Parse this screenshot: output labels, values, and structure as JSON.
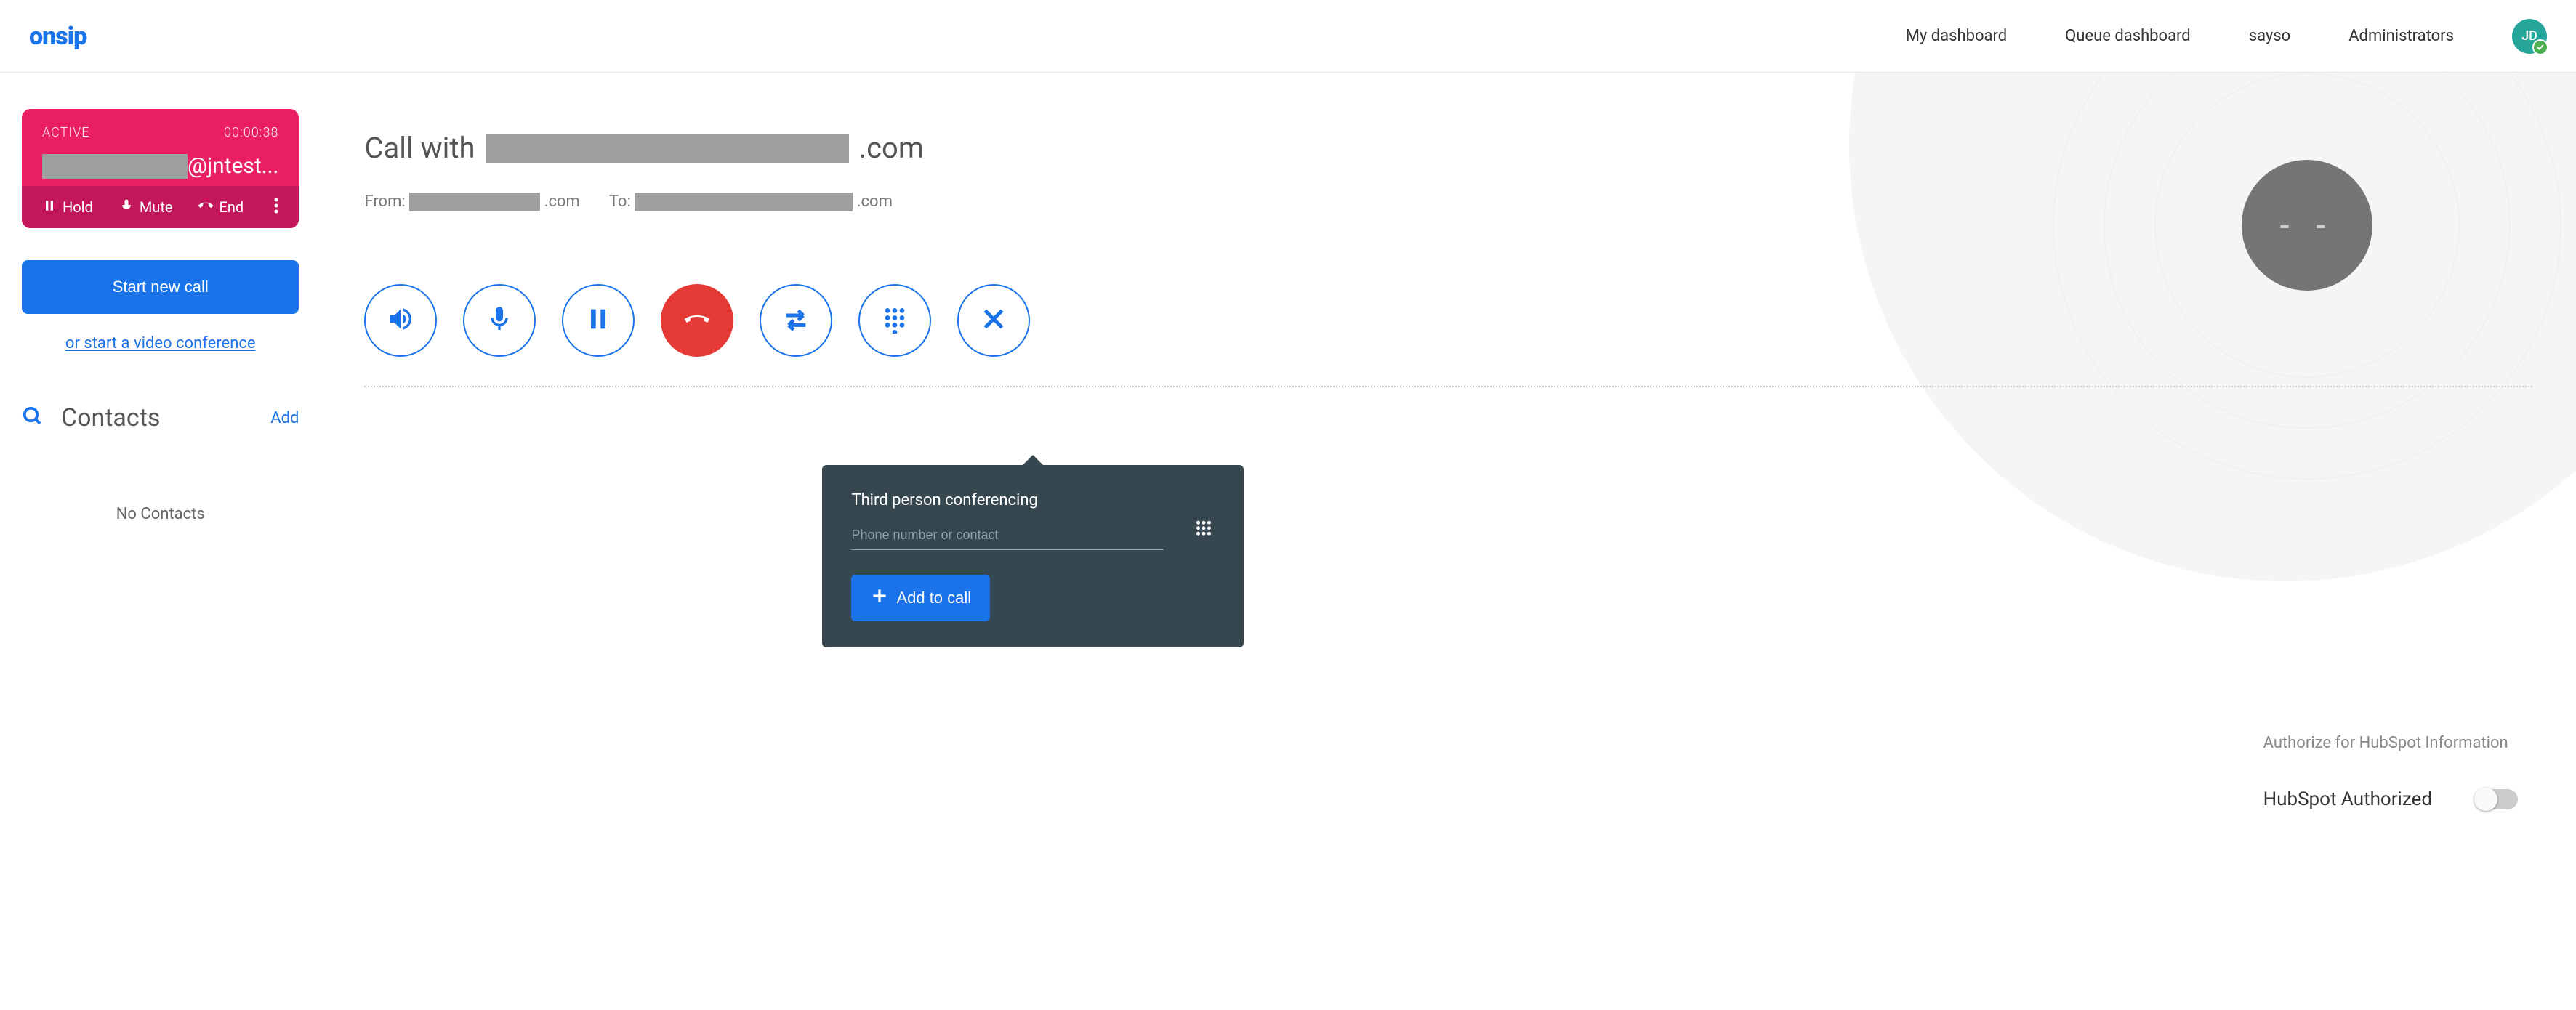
{
  "header": {
    "logo_text": "onsip",
    "nav": {
      "my_dashboard": "My dashboard",
      "queue_dashboard": "Queue dashboard",
      "sayso": "sayso",
      "administrators": "Administrators"
    },
    "avatar_initials": "JD"
  },
  "sidebar": {
    "call_card": {
      "status": "ACTIVE",
      "timer": "00:00:38",
      "caller_suffix": "@jntest...",
      "hold_label": "Hold",
      "mute_label": "Mute",
      "end_label": "End"
    },
    "new_call_button": "Start new call",
    "video_link": "or start a video conference",
    "contacts_heading": "Contacts",
    "add_link": "Add",
    "no_contacts": "No Contacts"
  },
  "content": {
    "call_with_prefix": "Call with",
    "call_with_suffix": ".com",
    "from_label": "From:",
    "from_suffix": ".com",
    "to_label": "To:",
    "to_suffix": ".com",
    "avatar_placeholder": "- -"
  },
  "popover": {
    "title": "Third person conferencing",
    "input_placeholder": "Phone number or contact",
    "add_button": "Add to call"
  },
  "hubspot": {
    "auth_label": "Authorize for HubSpot Information",
    "authorized_label": "HubSpot Authorized",
    "toggle_state": false
  },
  "colors": {
    "primary": "#1a73e8",
    "call_card": "#e91e63",
    "hangup": "#e53935",
    "popover": "#37474f",
    "avatar": "#26a69a"
  }
}
